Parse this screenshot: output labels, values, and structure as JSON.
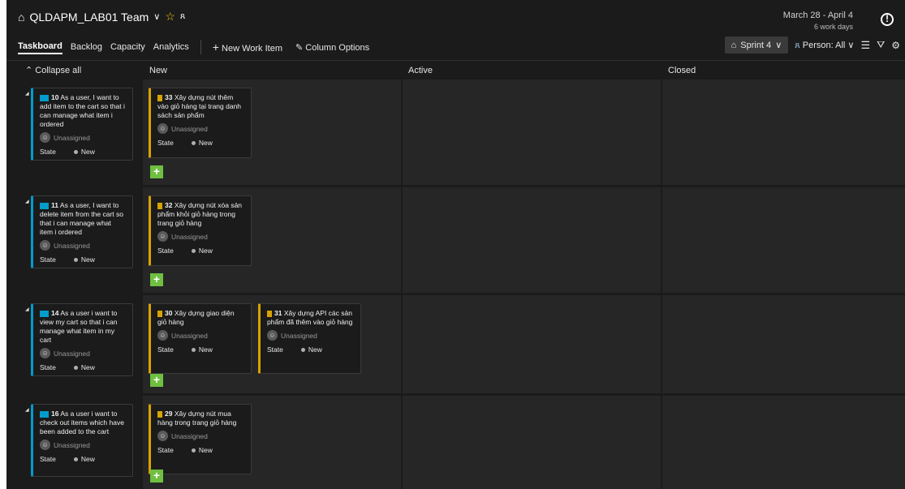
{
  "header": {
    "team_name": "QLDAPM_LAB01 Team",
    "dates": "March 28 - April 4",
    "work_days": "6 work days"
  },
  "nav": {
    "tabs": [
      "Taskboard",
      "Backlog",
      "Capacity",
      "Analytics"
    ],
    "new_work_item": "New Work Item",
    "column_options": "Column Options"
  },
  "toolbar": {
    "sprint": "Sprint 4",
    "person": "Person: All"
  },
  "board": {
    "collapse_all": "Collapse all",
    "columns": [
      "New",
      "Active",
      "Closed"
    ]
  },
  "lanes": [
    {
      "parent": {
        "id": "10",
        "title": "As a user, I want to add item to the cart so that i can manage what item i ordered",
        "assignee": "Unassigned",
        "state_label": "State",
        "state": "New"
      },
      "tasks": [
        {
          "id": "33",
          "title": "Xây dựng nút thêm vào giỏ hàng tại trang danh sách sản phẩm",
          "assignee": "Unassigned",
          "state_label": "State",
          "state": "New"
        }
      ]
    },
    {
      "parent": {
        "id": "11",
        "title": "As a user, I want to delete item from the cart so that i can manage what item i ordered",
        "assignee": "Unassigned",
        "state_label": "State",
        "state": "New"
      },
      "tasks": [
        {
          "id": "32",
          "title": "Xây dựng nút xóa sản phẩm khỏi giỏ hàng trong trang giỏ hàng",
          "assignee": "Unassigned",
          "state_label": "State",
          "state": "New"
        }
      ]
    },
    {
      "parent": {
        "id": "14",
        "title": "As a user i want to view my cart so that i can manage what item in my cart",
        "assignee": "Unassigned",
        "state_label": "State",
        "state": "New"
      },
      "tasks": [
        {
          "id": "30",
          "title": "Xây dựng giao diện giỏ hàng",
          "assignee": "Unassigned",
          "state_label": "State",
          "state": "New"
        },
        {
          "id": "31",
          "title": "Xây dựng API các sản phẩm đã thêm vào giỏ hàng",
          "assignee": "Unassigned",
          "state_label": "State",
          "state": "New"
        }
      ]
    },
    {
      "parent": {
        "id": "16",
        "title": "As a user i want to check out items which have been added to the cart",
        "assignee": "Unassigned",
        "state_label": "State",
        "state": "New"
      },
      "tasks": [
        {
          "id": "29",
          "title": "Xây dựng nút mua hàng trong trang giỏ hàng",
          "assignee": "Unassigned",
          "state_label": "State",
          "state": "New"
        }
      ]
    }
  ]
}
